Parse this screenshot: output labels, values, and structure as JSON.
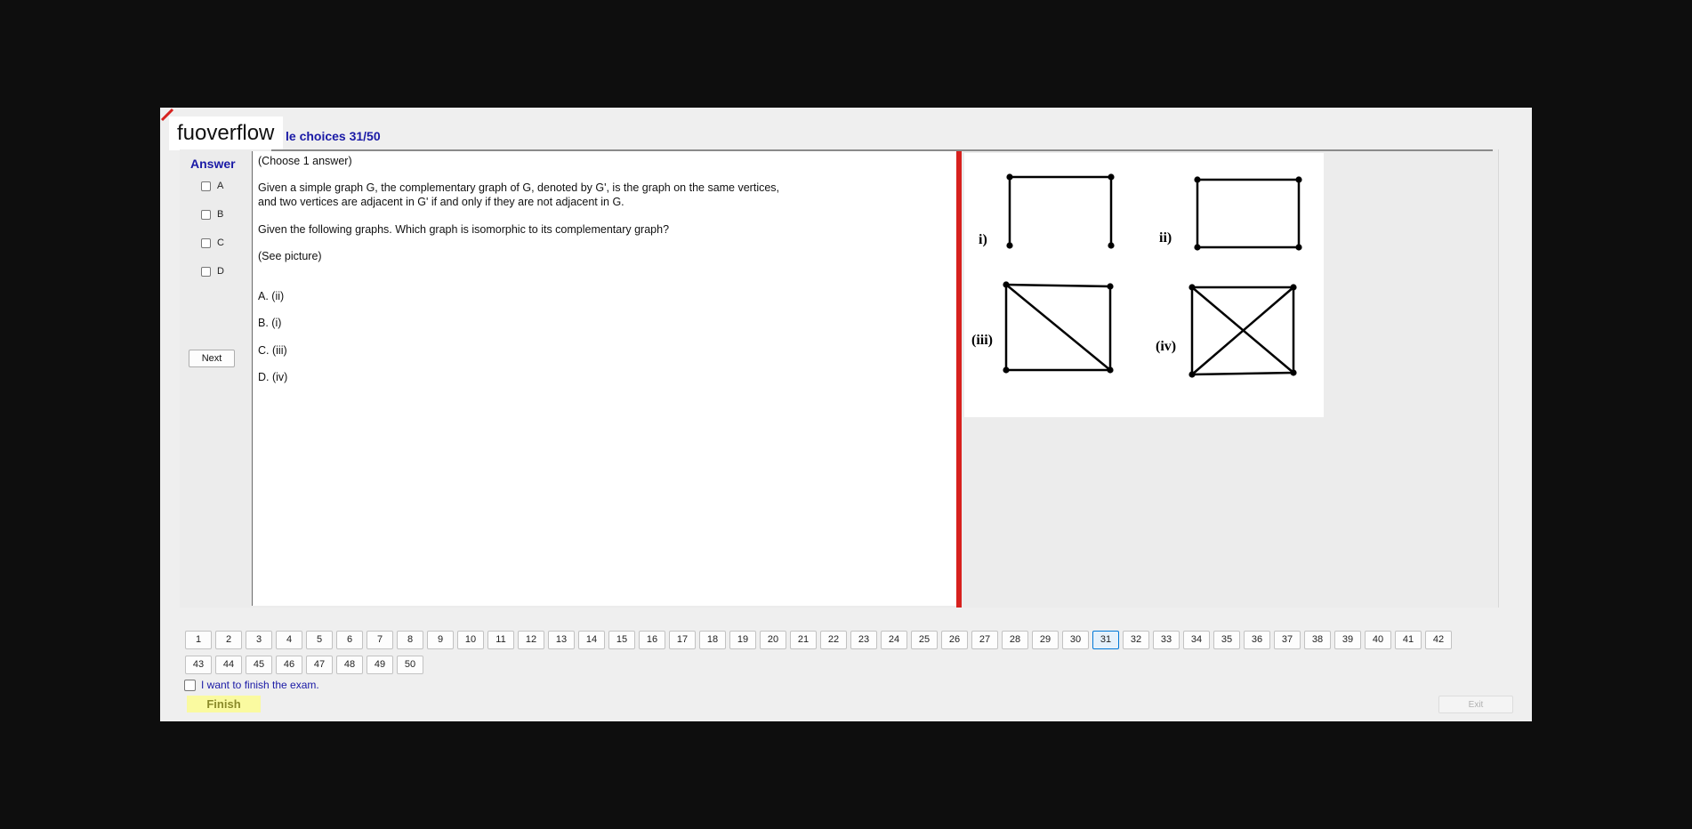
{
  "window": {
    "logo_text": "fuoverflow",
    "title": "le choices 31/50"
  },
  "answer": {
    "label": "Answer",
    "options": [
      "A",
      "B",
      "C",
      "D"
    ],
    "next_label": "Next"
  },
  "question": {
    "lines": [
      "(Choose 1 answer)",
      "Given a simple graph G, the complementary graph of G, denoted by G', is the graph on the same vertices,",
      "and two vertices are adjacent in G' if and only if they are not adjacent in G.",
      "Given the following graphs. Which graph is isomorphic to its complementary graph?",
      "(See picture)",
      "A.  (ii)",
      "B.  (i)",
      "C.  (iii)",
      "D.  (iv)"
    ]
  },
  "figure": {
    "labels": [
      "i)",
      "ii)",
      "(iii)",
      "(iv)"
    ]
  },
  "navigation": {
    "questions": [
      "1",
      "2",
      "3",
      "4",
      "5",
      "6",
      "7",
      "8",
      "9",
      "10",
      "11",
      "12",
      "13",
      "14",
      "15",
      "16",
      "17",
      "18",
      "19",
      "20",
      "21",
      "22",
      "23",
      "24",
      "25",
      "26",
      "27",
      "28",
      "29",
      "30",
      "31",
      "32",
      "33",
      "34",
      "35",
      "36",
      "37",
      "38",
      "39",
      "40",
      "41",
      "42",
      "43",
      "44",
      "45",
      "46",
      "47",
      "48",
      "49",
      "50"
    ],
    "current": "31"
  },
  "footer": {
    "finish_check_label": "I want to finish the exam.",
    "finish_label": "Finish",
    "exit_label": "Exit"
  },
  "colors": {
    "accent_blue": "#1a1aa6",
    "splitter_red": "#d7211e",
    "finish_yellow": "#fafaa0"
  }
}
